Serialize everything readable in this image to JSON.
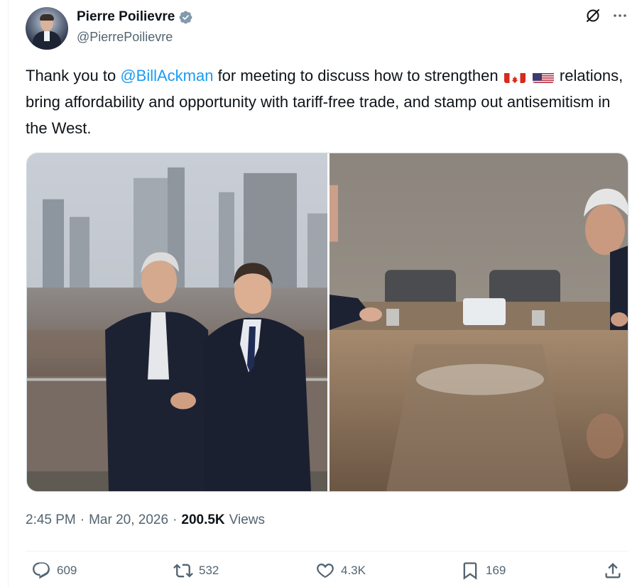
{
  "author": {
    "display_name": "Pierre Poilievre",
    "handle": "@PierrePoilievre",
    "verified": true,
    "avatar_icon": "profile-photo"
  },
  "header_icons": [
    "grok-icon",
    "more-icon"
  ],
  "tweet": {
    "text_before_mention": "Thank you to ",
    "mention": "@BillAckman",
    "text_after_mention": " for meeting to discuss how to strengthen ",
    "flag_1": "canada-flag",
    "flag_2": "usa-flag",
    "text_after_flags": " relations, bring affordability and opportunity with tariff-free trade, and stamp out antisemitism in the West."
  },
  "media": {
    "photos": [
      "handshake-photo",
      "conference-table-photo"
    ]
  },
  "meta": {
    "time": "2:45 PM",
    "separator": "·",
    "date": "Mar 20, 2026",
    "views_count": "200.5K",
    "views_label": "Views"
  },
  "actions": {
    "replies": "609",
    "reposts": "532",
    "likes": "4.3K",
    "bookmarks": "169"
  },
  "colors": {
    "accent": "#1d9bf0",
    "text": "#0f1419",
    "secondary": "#536471",
    "verified_badge": "#829aab"
  }
}
